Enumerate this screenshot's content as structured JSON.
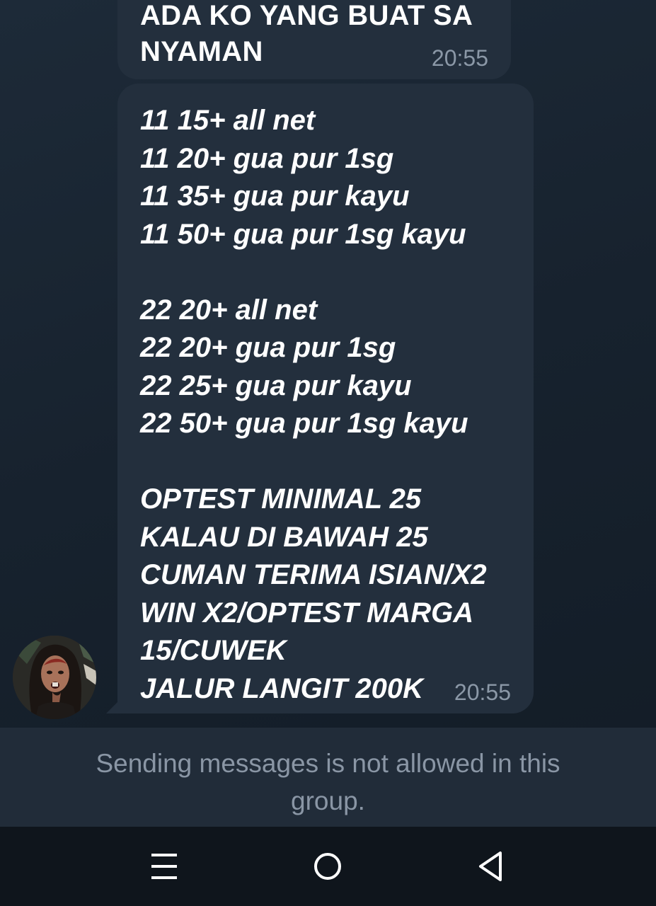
{
  "messages": [
    {
      "lines": [
        "ADA KO YANG BUAT SA",
        "NYAMAN"
      ],
      "time": "20:55"
    },
    {
      "lines": [
        "11 15+ all net",
        "11 20+ gua pur 1sg",
        "11 35+ gua pur kayu",
        "11 50+ gua pur 1sg kayu",
        "",
        "22 20+ all net",
        "22 20+ gua pur 1sg",
        "22 25+ gua pur kayu",
        "22 50+ gua pur 1sg kayu",
        "",
        "OPTEST MINIMAL 25",
        "KALAU DI BAWAH 25",
        "CUMAN TERIMA ISIAN/X2",
        "WIN X2/OPTEST MARGA",
        "15/CUWEK",
        "JALUR LANGIT 200K"
      ],
      "time": "20:55"
    }
  ],
  "notice": {
    "text": "Sending messages is not allowed in this group."
  },
  "nav": {
    "icons": [
      "menu-icon",
      "home-icon",
      "back-icon"
    ]
  },
  "colors": {
    "background": "#17222e",
    "bubble": "#232f3d",
    "time_text": "#8b98a7",
    "notice_bar": "#212c39",
    "notice_text": "#8a96a5",
    "nav_bar": "#0f151c"
  }
}
